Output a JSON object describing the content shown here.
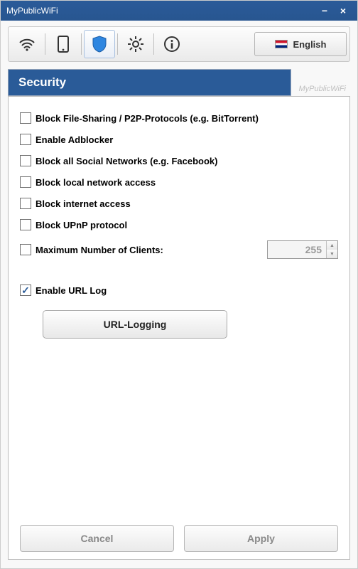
{
  "window": {
    "title": "MyPublicWiFi"
  },
  "language": {
    "label": "English"
  },
  "section": {
    "title": "Security",
    "watermark": "MyPublicWiFi"
  },
  "checkboxes": {
    "block_p2p": {
      "label": "Block File-Sharing / P2P-Protocols (e.g. BitTorrent)",
      "checked": false
    },
    "enable_adblocker": {
      "label": "Enable Adblocker",
      "checked": false
    },
    "block_social": {
      "label": "Block all Social Networks (e.g. Facebook)",
      "checked": false
    },
    "block_local": {
      "label": "Block local network access",
      "checked": false
    },
    "block_internet": {
      "label": "Block internet access",
      "checked": false
    },
    "block_upnp": {
      "label": "Block UPnP protocol",
      "checked": false
    },
    "max_clients": {
      "label": "Maximum Number of Clients:",
      "checked": false,
      "value": "255"
    },
    "enable_url_log": {
      "label": "Enable URL Log",
      "checked": true
    }
  },
  "buttons": {
    "url_logging": "URL-Logging",
    "cancel": "Cancel",
    "apply": "Apply"
  }
}
